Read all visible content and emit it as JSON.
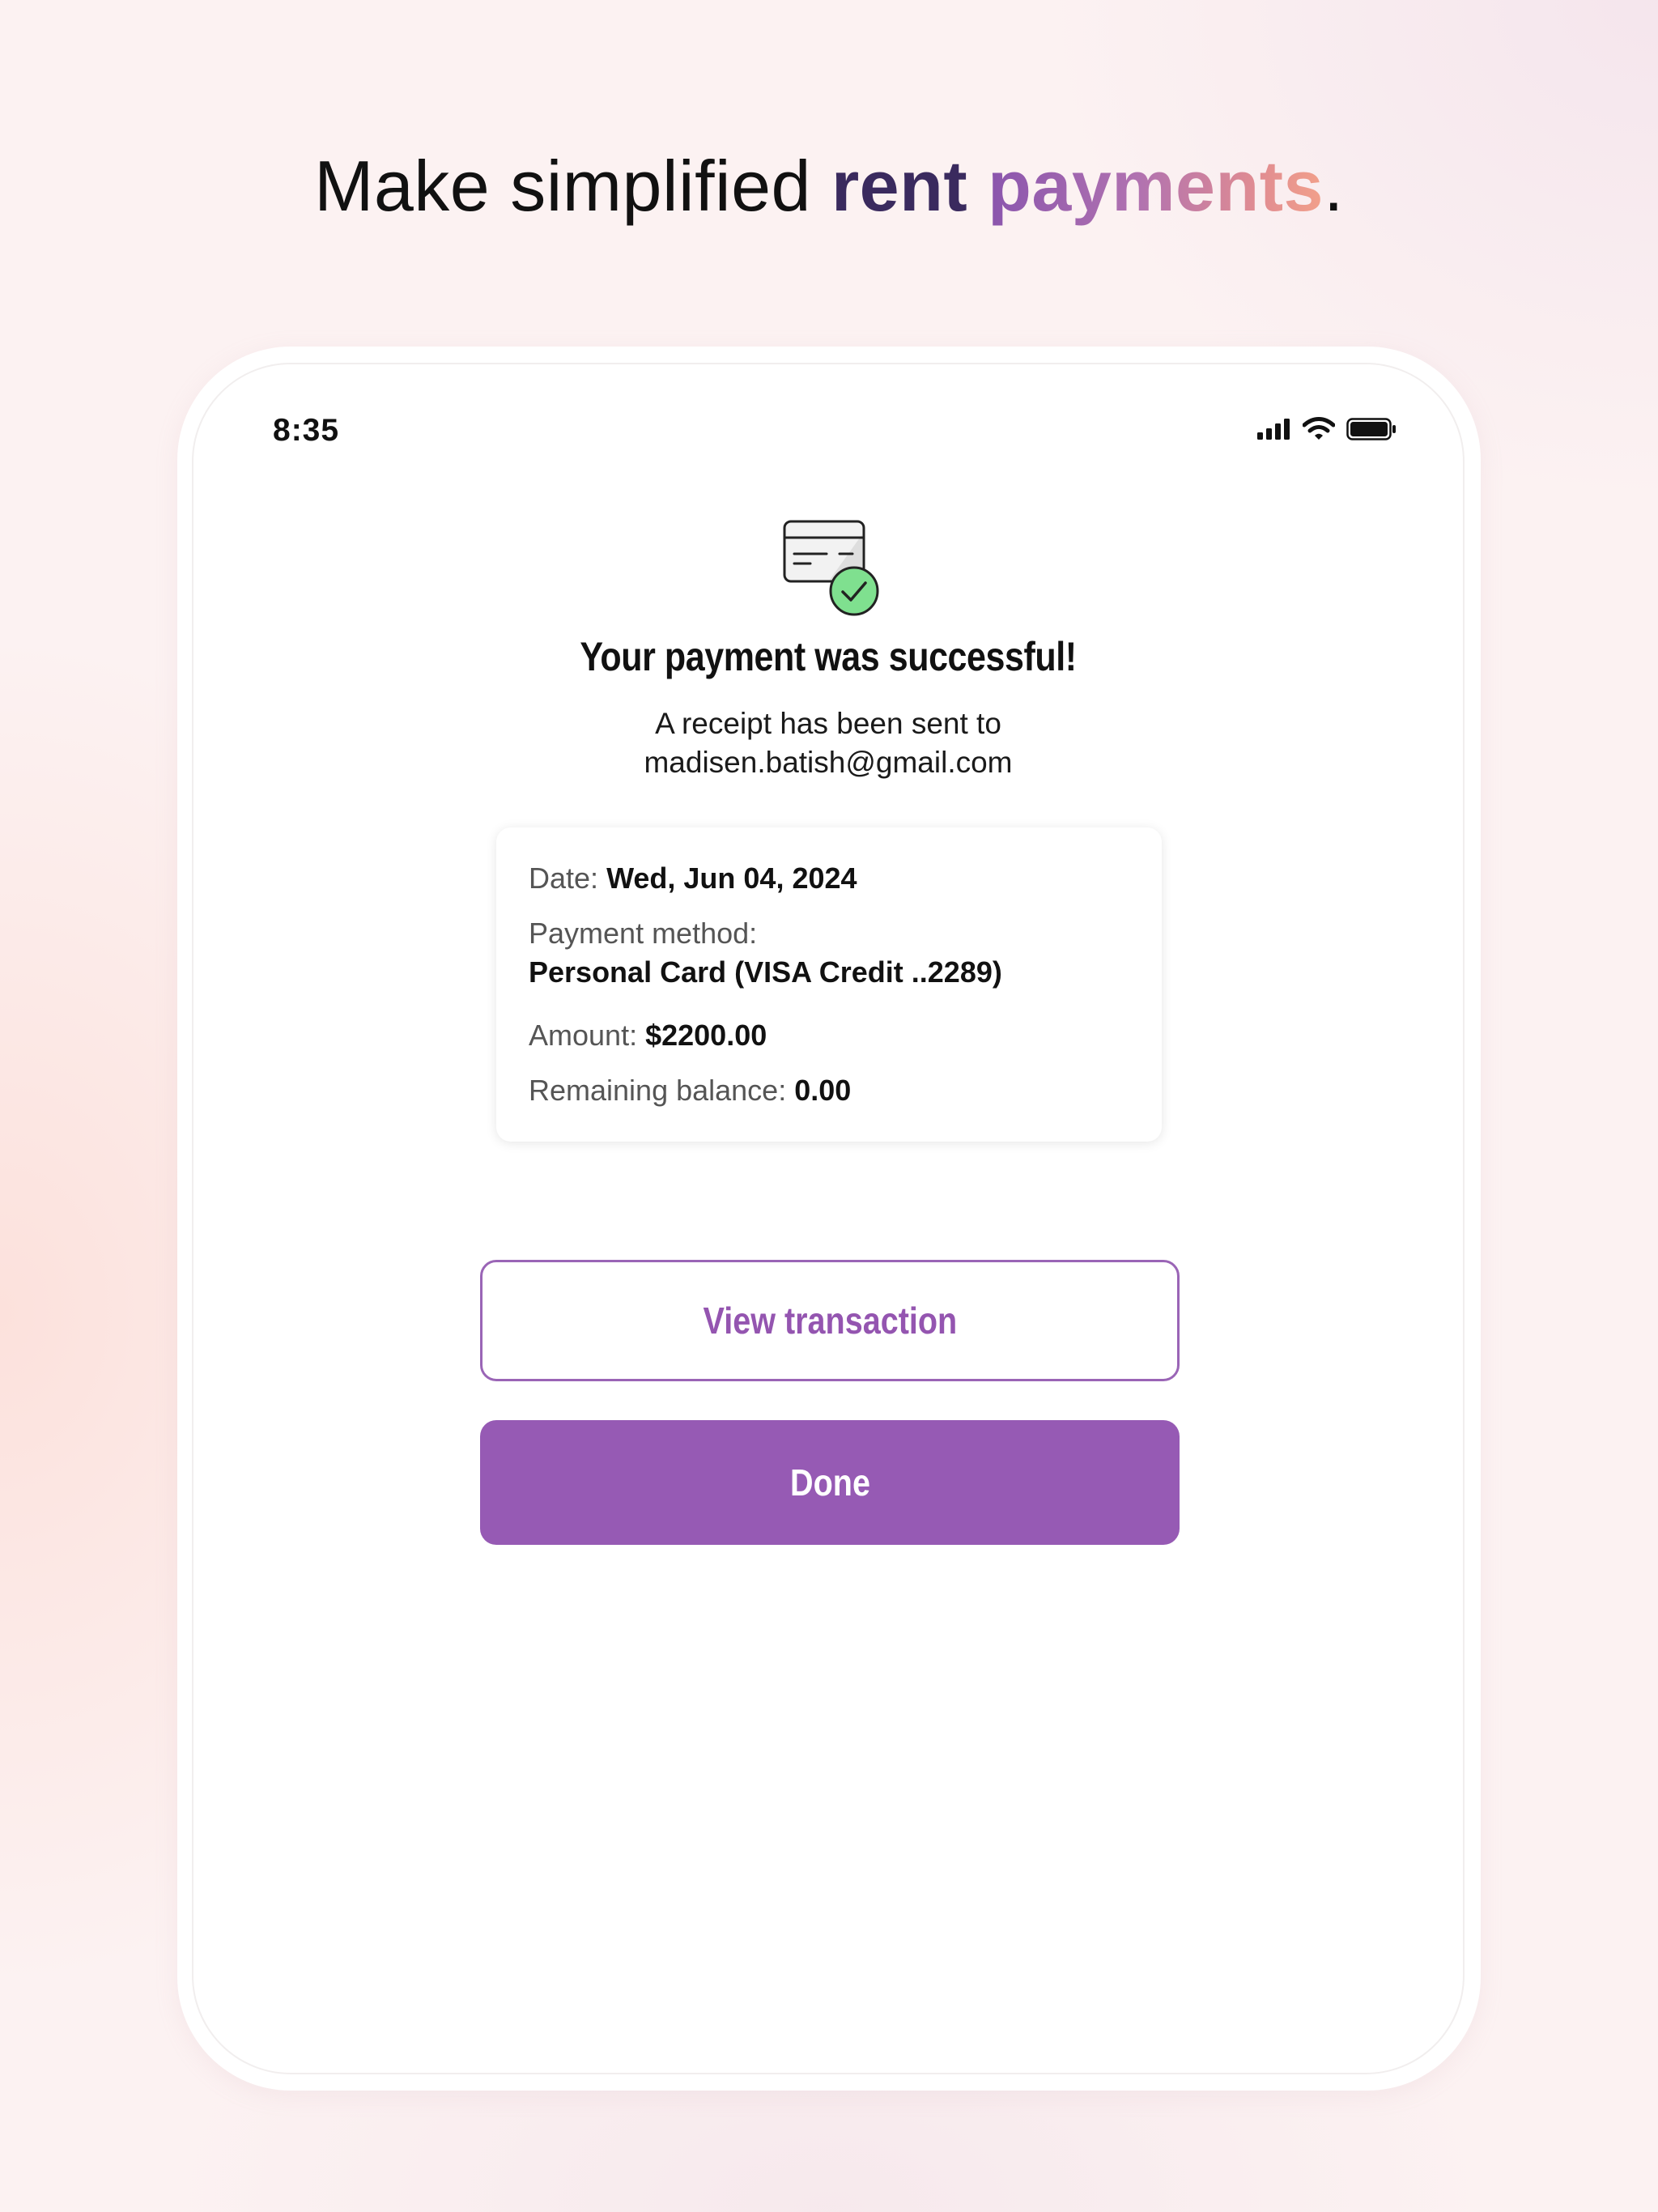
{
  "headline": {
    "lead": "Make simplified ",
    "highlight_1": "rent",
    "space": " ",
    "highlight_2": "payments",
    "end": "."
  },
  "colors": {
    "accent": "#965ab4",
    "accent_dark": "#3a2a5e",
    "success_green": "#5fd37a"
  },
  "status_bar": {
    "time": "8:35",
    "icons": [
      "cellular-signal-icon",
      "wifi-icon",
      "battery-icon"
    ]
  },
  "payment": {
    "icon": "card-check-icon",
    "title": "Your payment was successful!",
    "receipt_line1": "A receipt has been sent to",
    "receipt_email": "madisen.batish@gmail.com",
    "details": {
      "date_label": "Date:",
      "date_value": "Wed, Jun 04, 2024",
      "method_label": "Payment method:",
      "method_value": "Personal Card (VISA Credit ..2289)",
      "amount_label": "Amount:",
      "amount_value": "$2200.00",
      "balance_label": "Remaining balance:",
      "balance_value": "0.00"
    },
    "view_transaction_label": "View transaction",
    "done_label": "Done"
  }
}
